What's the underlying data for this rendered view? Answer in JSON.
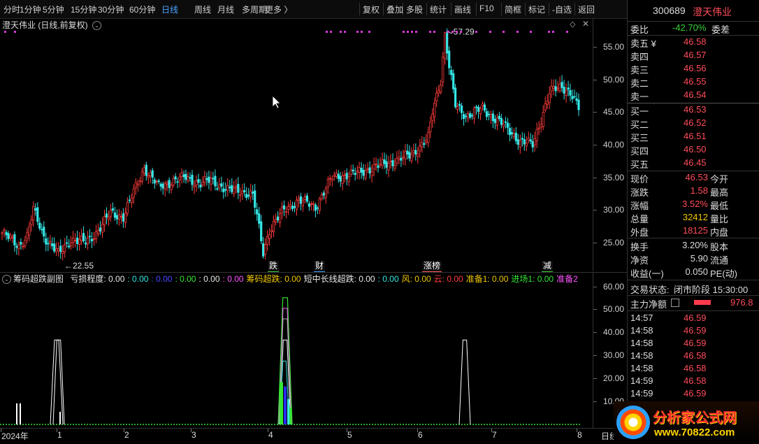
{
  "toolbar": {
    "left_items": [
      "分时",
      "1分钟",
      "5分钟",
      "15分钟",
      "30分钟",
      "60分钟",
      "日线",
      "周线",
      "月线",
      "多周期",
      "更多 〉"
    ],
    "active": "日线",
    "right_items": [
      "复权",
      "叠加",
      "多股",
      "统计",
      "画线",
      "F10",
      "简框",
      "标记",
      "-自选",
      "返回"
    ]
  },
  "chart": {
    "title": "澄天伟业 (日线,前复权)",
    "high_label": "57.29",
    "low_label": "22.55",
    "price_ticks": [
      "55.00",
      "50.00",
      "45.00",
      "40.00",
      "35.00",
      "30.00",
      "25.00"
    ],
    "event_tags": [
      {
        "text": "跌",
        "color": "#33cc33",
        "x": 0.452
      },
      {
        "text": "财",
        "color": "#3399ff",
        "x": 0.53
      },
      {
        "text": "涨榜",
        "color": "#ff5555",
        "x": 0.712
      },
      {
        "text": "减",
        "color": "#33cc33",
        "x": 0.914
      }
    ],
    "colors": {
      "up": "#ff3b3b",
      "down": "#35e6e6",
      "marker": "#d43bd4"
    }
  },
  "indicator": {
    "title": "筹码超跌副图",
    "legend": [
      {
        "text": "亏损程度: 0.00",
        "color": "#e8e8e8"
      },
      {
        "text": ": 0.00",
        "color": "#35e6e6"
      },
      {
        "text": ": 0.00",
        "color": "#4a4aff"
      },
      {
        "text": ": 0.00",
        "color": "#35e635"
      },
      {
        "text": ": 0.00",
        "color": "#e8e8e8"
      },
      {
        "text": ": 0.00",
        "color": "#ff55ff"
      },
      {
        "text": "筹码超跌: 0.00",
        "color": "#f0c800"
      },
      {
        "text": "短中长线超跌: 0.00",
        "color": "#e8e8e8"
      },
      {
        "text": ": 0.00",
        "color": "#35e6e6"
      },
      {
        "text": "风: 0.00",
        "color": "#f0c800"
      },
      {
        "text": "云: 0.00",
        "color": "#ff3b3b"
      },
      {
        "text": "准备1: 0.00",
        "color": "#f0c800"
      },
      {
        "text": "进场1: 0.00",
        "color": "#35e635"
      },
      {
        "text": "准备2",
        "color": "#ff55ff"
      }
    ],
    "ticks": [
      "60.00",
      "50.00",
      "40.00",
      "30.00",
      "20.00",
      "10.00"
    ]
  },
  "xaxis": {
    "labels": [
      "2024年",
      "1",
      "2",
      "3",
      "4",
      "5",
      "6",
      "7",
      "8"
    ],
    "end_label": "日线"
  },
  "quote": {
    "code": "300689",
    "name": "澄天伟业",
    "weibi_label": "委比",
    "weibi_value": "-42.70%",
    "weicha_label": "委差",
    "asks": [
      {
        "label": "卖五 ¥",
        "price": "46.58"
      },
      {
        "label": "卖四",
        "price": "46.57"
      },
      {
        "label": "卖三",
        "price": "46.56"
      },
      {
        "label": "卖二",
        "price": "46.55"
      },
      {
        "label": "卖一",
        "price": "46.54"
      }
    ],
    "bids": [
      {
        "label": "买一",
        "price": "46.53"
      },
      {
        "label": "买二",
        "price": "46.52"
      },
      {
        "label": "买三",
        "price": "46.51"
      },
      {
        "label": "买四",
        "price": "46.50"
      },
      {
        "label": "买五",
        "price": "46.45"
      }
    ],
    "stats": [
      {
        "l1": "现价",
        "v1": "46.53",
        "c1": "red",
        "l2": "今开",
        "v2": ""
      },
      {
        "l1": "涨跌",
        "v1": "1.58",
        "c1": "red",
        "l2": "最高",
        "v2": ""
      },
      {
        "l1": "涨幅",
        "v1": "3.52%",
        "c1": "red",
        "l2": "最低",
        "v2": ""
      },
      {
        "l1": "总量",
        "v1": "32412",
        "c1": "yellow",
        "l2": "量比",
        "v2": ""
      },
      {
        "l1": "外盘",
        "v1": "18125",
        "c1": "red",
        "l2": "内盘",
        "v2": ""
      }
    ],
    "stats2": [
      {
        "l1": "换手",
        "v1": "3.20%",
        "l2": "股本"
      },
      {
        "l1": "净资",
        "v1": "5.90",
        "l2": "流通"
      },
      {
        "l1": "收益(一)",
        "v1": "0.050",
        "l2": "PE(动)"
      }
    ],
    "status_label": "交易状态:",
    "status_value": "闭市阶段 15:30:00",
    "net_label": "主力净额",
    "net_value": "976.8",
    "ticks": [
      {
        "time": "14:57",
        "price": "46.59"
      },
      {
        "time": "14:58",
        "price": "46.59"
      },
      {
        "time": "14:58",
        "price": "46.59"
      },
      {
        "time": "14:58",
        "price": "46.58"
      },
      {
        "time": "14:58",
        "price": "46.58"
      },
      {
        "time": "14:59",
        "price": "46.58"
      },
      {
        "time": "14:59",
        "price": "46.59"
      }
    ]
  },
  "watermark": {
    "brand": "分析家公式网",
    "url": "www.70822.com"
  }
}
